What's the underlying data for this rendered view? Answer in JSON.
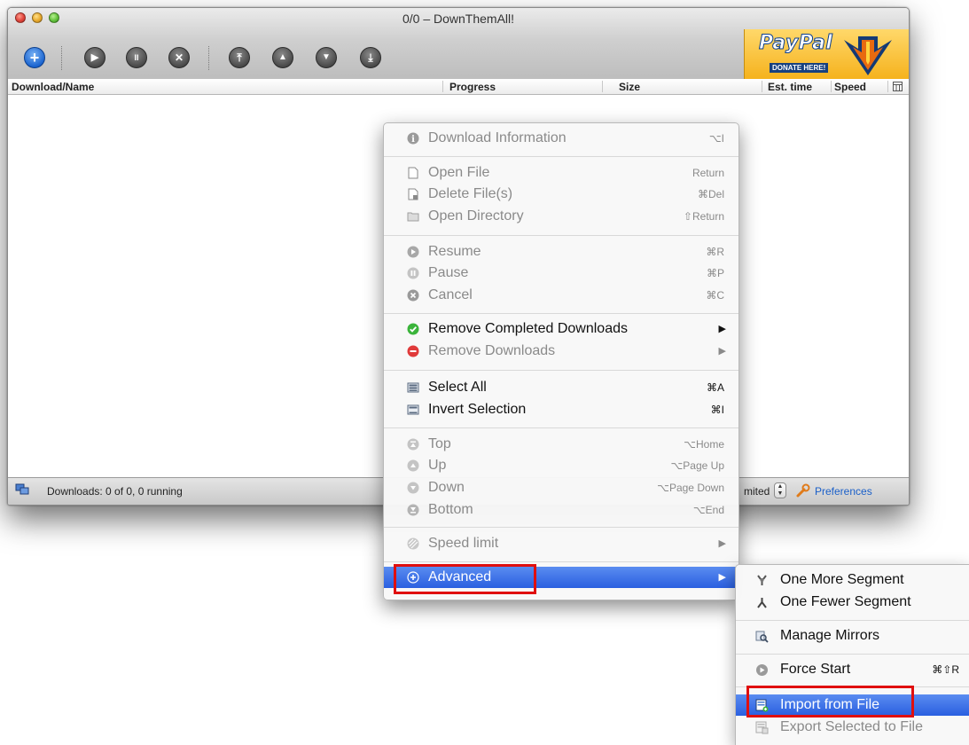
{
  "window": {
    "title": "0/0 – DownThemAll!"
  },
  "toolbar": {
    "add_glyph": "+",
    "resume_glyph": "▶",
    "pause_glyph": "II",
    "cancel_glyph": "✕",
    "top_glyph": "⤒",
    "up_glyph": "▲",
    "down_glyph": "▼",
    "bottom_glyph": "⤓"
  },
  "paypal": {
    "brand": "PayPal",
    "donate": "DONATE HERE!"
  },
  "columns": [
    "Download/Name",
    "Progress",
    "Size",
    "Est. time",
    "Speed"
  ],
  "statusbar": {
    "downloads": "Downloads: 0 of 0, 0 running",
    "limit_fragment": "mited",
    "stepper_up": "▲",
    "stepper_down": "▼",
    "preferences": "Preferences"
  },
  "context_menu": {
    "items": [
      {
        "label": "Download Information",
        "shortcut": "⌥I",
        "enabled": false,
        "icon": "info-icon"
      },
      {
        "label": "Open File",
        "shortcut": "Return",
        "enabled": false,
        "icon": "document-icon"
      },
      {
        "label": "Delete File(s)",
        "shortcut": "⌘Del",
        "enabled": false,
        "icon": "delete-document-icon"
      },
      {
        "label": "Open Directory",
        "shortcut": "⇧Return",
        "enabled": false,
        "icon": "folder-icon"
      },
      {
        "label": "Resume",
        "shortcut": "⌘R",
        "enabled": false,
        "icon": "resume-icon"
      },
      {
        "label": "Pause",
        "shortcut": "⌘P",
        "enabled": false,
        "icon": "pause-icon"
      },
      {
        "label": "Cancel",
        "shortcut": "⌘C",
        "enabled": false,
        "icon": "cancel-icon"
      },
      {
        "label": "Remove Completed Downloads",
        "shortcut": "▶",
        "enabled": true,
        "icon": "checkmark-icon"
      },
      {
        "label": "Remove Downloads",
        "shortcut": "▶",
        "enabled": false,
        "icon": "remove-icon"
      },
      {
        "label": "Select All",
        "shortcut": "⌘A",
        "enabled": true,
        "icon": "select-all-icon"
      },
      {
        "label": "Invert Selection",
        "shortcut": "⌘I",
        "enabled": true,
        "icon": "invert-selection-icon"
      },
      {
        "label": "Top",
        "shortcut": "⌥Home",
        "enabled": false,
        "icon": "move-top-icon"
      },
      {
        "label": "Up",
        "shortcut": "⌥Page Up",
        "enabled": false,
        "icon": "move-up-icon"
      },
      {
        "label": "Down",
        "shortcut": "⌥Page Down",
        "enabled": false,
        "icon": "move-down-icon"
      },
      {
        "label": "Bottom",
        "shortcut": "⌥End",
        "enabled": false,
        "icon": "move-bottom-icon"
      },
      {
        "label": "Speed limit",
        "shortcut": "▶",
        "enabled": false,
        "icon": "speed-limit-icon"
      },
      {
        "label": "Advanced",
        "shortcut": "▶",
        "enabled": true,
        "icon": "plus-circle-icon",
        "highlighted": true
      }
    ]
  },
  "advanced_submenu": {
    "items": [
      {
        "label": "One More Segment",
        "shortcut": "",
        "enabled": true,
        "icon": "add-segment-icon"
      },
      {
        "label": "One Fewer Segment",
        "shortcut": "",
        "enabled": true,
        "icon": "remove-segment-icon"
      },
      {
        "label": "Manage Mirrors",
        "shortcut": "",
        "enabled": true,
        "icon": "mirrors-icon"
      },
      {
        "label": "Force Start",
        "shortcut": "⌘⇧R",
        "enabled": true,
        "icon": "force-start-icon"
      },
      {
        "label": "Import from File",
        "shortcut": "",
        "enabled": true,
        "icon": "import-icon",
        "highlighted": true
      },
      {
        "label": "Export Selected to File",
        "shortcut": "",
        "enabled": false,
        "icon": "export-icon"
      }
    ]
  },
  "colors": {
    "highlight": "#2a5fe0",
    "annotation_red": "#e00f0f",
    "toolbar_blue": "#1b64cf"
  }
}
